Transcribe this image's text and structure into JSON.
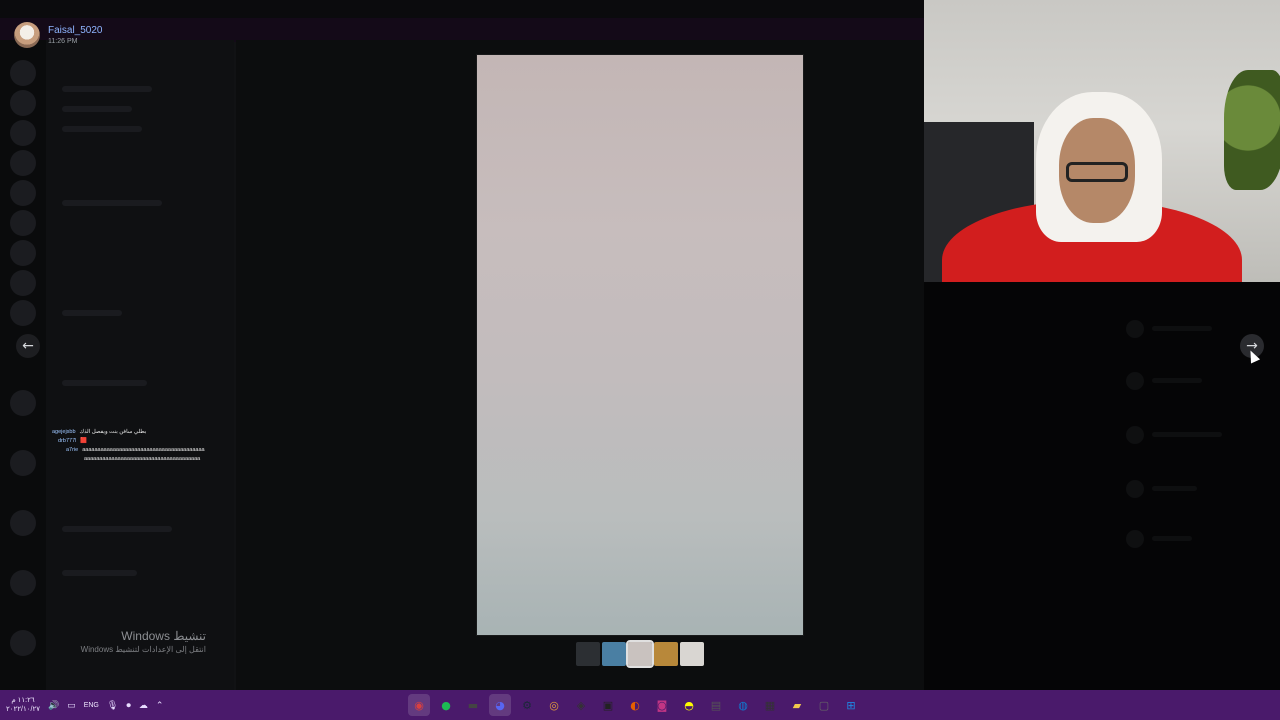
{
  "uploader": {
    "name": "Faisal_5020",
    "time": "11:26 PM"
  },
  "viewer": {
    "prev_icon": "arrow-left-icon",
    "next_icon": "arrow-right-icon",
    "prev_glyph": "←",
    "next_glyph": "→"
  },
  "chat": [
    {
      "user": "agejejsbb",
      "msg": "بطلي سافن بنت ويفصل الذك"
    },
    {
      "user": "drb777l",
      "msg": "🟥"
    },
    {
      "user": "a7rie",
      "msg": "aaaaaaaaaaaaaaaaaaaaaaaaaaaaaaaaaaaaaaaa"
    },
    {
      "user": "",
      "msg": "aaaaaaaaaaaaaaaaaaaaaaaaaaaaaaaaaaaaaa"
    }
  ],
  "watermark": {
    "title": "تنشيط Windows",
    "subtitle": "انتقل إلى الإعدادات لتنشيط Windows"
  },
  "thumbnails": [
    {
      "color": "#2c2f33"
    },
    {
      "color": "#4a7fa3"
    },
    {
      "color": "#c9c2bf",
      "active": true
    },
    {
      "color": "#b8883a"
    },
    {
      "color": "#d9d6d2"
    }
  ],
  "taskbar": {
    "clock_time": "١١:٢٦ م",
    "clock_date": "٢٠٢٢/١٠/٢٧",
    "language": "ENG",
    "tray_icons": [
      {
        "name": "volume-icon",
        "glyph": "🔊"
      },
      {
        "name": "display-icon",
        "glyph": "▭"
      },
      {
        "name": "mic-icon",
        "glyph": "🎙"
      },
      {
        "name": "record-icon",
        "glyph": "⏺"
      },
      {
        "name": "cloud-icon",
        "glyph": "☁"
      },
      {
        "name": "chevron-up-icon",
        "glyph": "⌃"
      }
    ],
    "apps": [
      {
        "name": "obs-icon",
        "glyph": "◉",
        "color": "#d94040",
        "active": true
      },
      {
        "name": "spotify-icon",
        "glyph": "●",
        "color": "#1db954"
      },
      {
        "name": "terminal-icon",
        "glyph": "▬",
        "color": "#444"
      },
      {
        "name": "discord-icon",
        "glyph": "◕",
        "color": "#5865f2",
        "active": true
      },
      {
        "name": "steam-icon",
        "glyph": "⚙",
        "color": "#1b2838"
      },
      {
        "name": "chrome-icon",
        "glyph": "◎",
        "color": "#e8a23a"
      },
      {
        "name": "media-icon",
        "glyph": "◈",
        "color": "#333"
      },
      {
        "name": "gpu-icon",
        "glyph": "▣",
        "color": "#222"
      },
      {
        "name": "firefox-icon",
        "glyph": "◐",
        "color": "#e66000"
      },
      {
        "name": "instagram-icon",
        "glyph": "◙",
        "color": "#c13584"
      },
      {
        "name": "snapchat-icon",
        "glyph": "◓",
        "color": "#fffc00"
      },
      {
        "name": "keyboard-icon",
        "glyph": "▤",
        "color": "#555"
      },
      {
        "name": "edge-icon",
        "glyph": "◍",
        "color": "#0f7bd1"
      },
      {
        "name": "video-editor-icon",
        "glyph": "▦",
        "color": "#333"
      },
      {
        "name": "folder-icon",
        "glyph": "▰",
        "color": "#f2c94c"
      },
      {
        "name": "window-icon",
        "glyph": "▢",
        "color": "#666"
      },
      {
        "name": "start-icon",
        "glyph": "⊞",
        "color": "#1e88e5"
      }
    ]
  }
}
